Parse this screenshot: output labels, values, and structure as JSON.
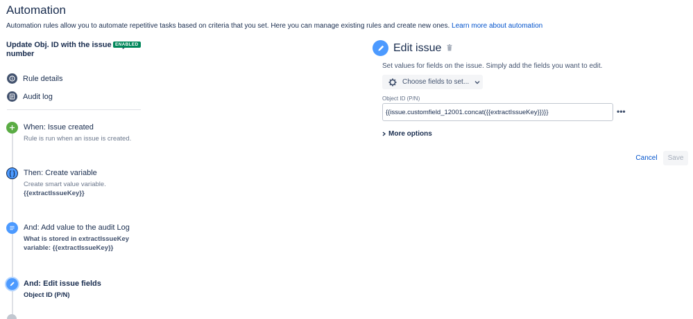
{
  "page": {
    "title": "Automation",
    "description": "Automation rules allow you to automate repetitive tasks based on criteria that you set. Here you can manage existing rules and create new ones.",
    "learn_more": "Learn more about automation"
  },
  "rule": {
    "title": "Update Obj. ID with the issue key number",
    "status": "ENABLED"
  },
  "nav": {
    "rule_details": "Rule details",
    "audit_log": "Audit log"
  },
  "steps": [
    {
      "title": "When: Issue created",
      "subtitle": "Rule is run when an issue is created."
    },
    {
      "title": "Then: Create variable",
      "subtitle": "Create smart value variable.",
      "detail": "{{extractIssueKey}}"
    },
    {
      "title": "And: Add value to the audit Log",
      "detail": "What is stored in extractIssueKey variable: {{extractIssueKey}}"
    },
    {
      "title": "And: Edit issue fields",
      "detail": "Object ID (P/N)"
    }
  ],
  "edit_panel": {
    "title": "Edit issue",
    "description": "Set values for fields on the issue. Simply add the fields you want to edit.",
    "choose_fields_label": "Choose fields to set...",
    "field_label": "Object ID (P/N)",
    "field_value": "{{issue.customfield_12001.concat({{extractIssueKey}})}}",
    "more_options": "More options",
    "cancel": "Cancel",
    "save": "Save"
  },
  "colors": {
    "enabled_badge": "#00875a",
    "trigger_green": "#5aac44",
    "action_blue": "#4c9aff",
    "link_blue": "#0052cc"
  }
}
